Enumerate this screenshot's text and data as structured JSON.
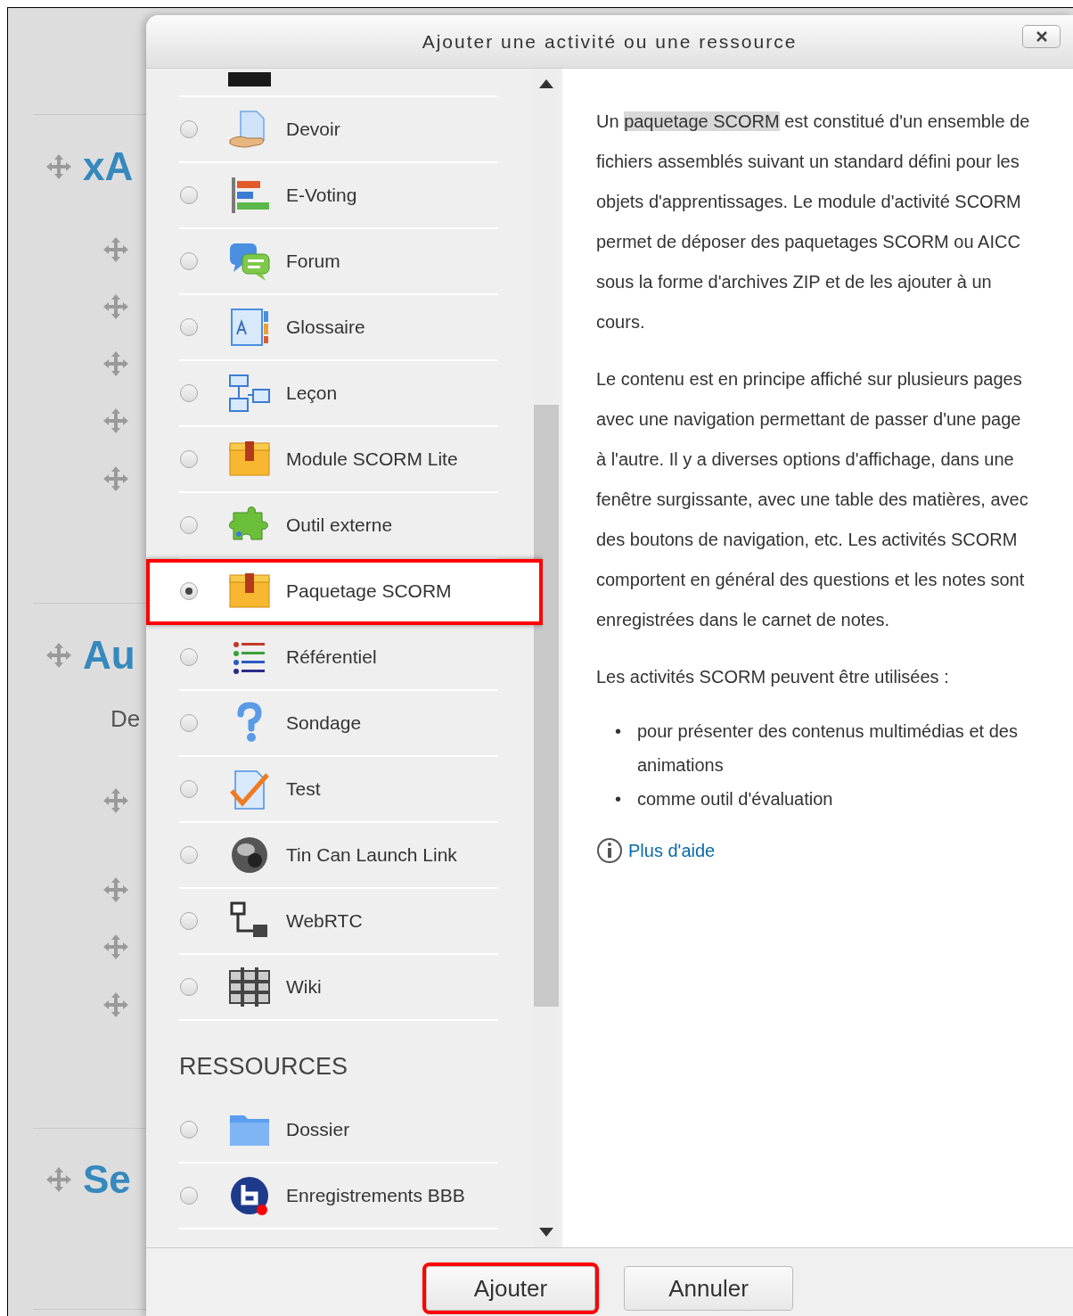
{
  "page": {
    "sections": [
      {
        "title": "xA"
      },
      {
        "title": "Au",
        "text": "De"
      },
      {
        "title": "Se"
      }
    ]
  },
  "dialog": {
    "title": "Ajouter une activité ou une ressource",
    "activities": [
      {
        "label": "Devoir",
        "selected": false,
        "highlighted": false
      },
      {
        "label": "E-Voting",
        "selected": false,
        "highlighted": false
      },
      {
        "label": "Forum",
        "selected": false,
        "highlighted": false
      },
      {
        "label": "Glossaire",
        "selected": false,
        "highlighted": false
      },
      {
        "label": "Leçon",
        "selected": false,
        "highlighted": false
      },
      {
        "label": "Module SCORM Lite",
        "selected": false,
        "highlighted": false
      },
      {
        "label": "Outil externe",
        "selected": false,
        "highlighted": false
      },
      {
        "label": "Paquetage SCORM",
        "selected": true,
        "highlighted": true
      },
      {
        "label": "Référentiel",
        "selected": false,
        "highlighted": false
      },
      {
        "label": "Sondage",
        "selected": false,
        "highlighted": false
      },
      {
        "label": "Test",
        "selected": false,
        "highlighted": false
      },
      {
        "label": "Tin Can Launch Link",
        "selected": false,
        "highlighted": false
      },
      {
        "label": "WebRTC",
        "selected": false,
        "highlighted": false
      },
      {
        "label": "Wiki",
        "selected": false,
        "highlighted": false
      }
    ],
    "resources": {
      "heading": "RESSOURCES",
      "items": [
        {
          "label": "Dossier",
          "selected": false,
          "highlighted": false
        },
        {
          "label": "Enregistrements BBB",
          "selected": false,
          "highlighted": false
        }
      ]
    },
    "help": {
      "paragraphs": [
        [
          {
            "text": "Un ",
            "highlighted": false
          },
          {
            "text": "paquetage SCORM",
            "highlighted": true
          },
          {
            "text": " est constitué d'un ensemble de fichiers assemblés suivant un standard défini pour les objets d'apprentissages. Le module d'activité SCORM permet de déposer des paquetages SCORM ou AICC sous la forme d'archives ZIP et de les ajouter à un cours.",
            "highlighted": false
          }
        ],
        [
          {
            "text": "Le contenu est en principe affiché sur plusieurs pages avec une navigation permettant de passer d'une page à l'autre. Il y a diverses options d'affichage, dans une fenêtre surgissante, avec une table des matières, avec des boutons de navigation, etc. Les activités SCORM comportent en général des questions et les notes sont enregistrées dans le carnet de notes.",
            "highlighted": false
          }
        ],
        [
          {
            "text": "Les activités SCORM peuvent être utilisées :",
            "highlighted": false
          }
        ]
      ],
      "bullets": [
        {
          "marker": "•",
          "text": "pour présenter des contenus multimédias et des animations"
        },
        {
          "marker": "•",
          "text": "comme outil d'évaluation"
        }
      ],
      "link": "Plus d'aide"
    },
    "buttons": [
      {
        "label": "Ajouter",
        "highlighted": true
      },
      {
        "label": "Annuler",
        "highlighted": false
      }
    ]
  }
}
